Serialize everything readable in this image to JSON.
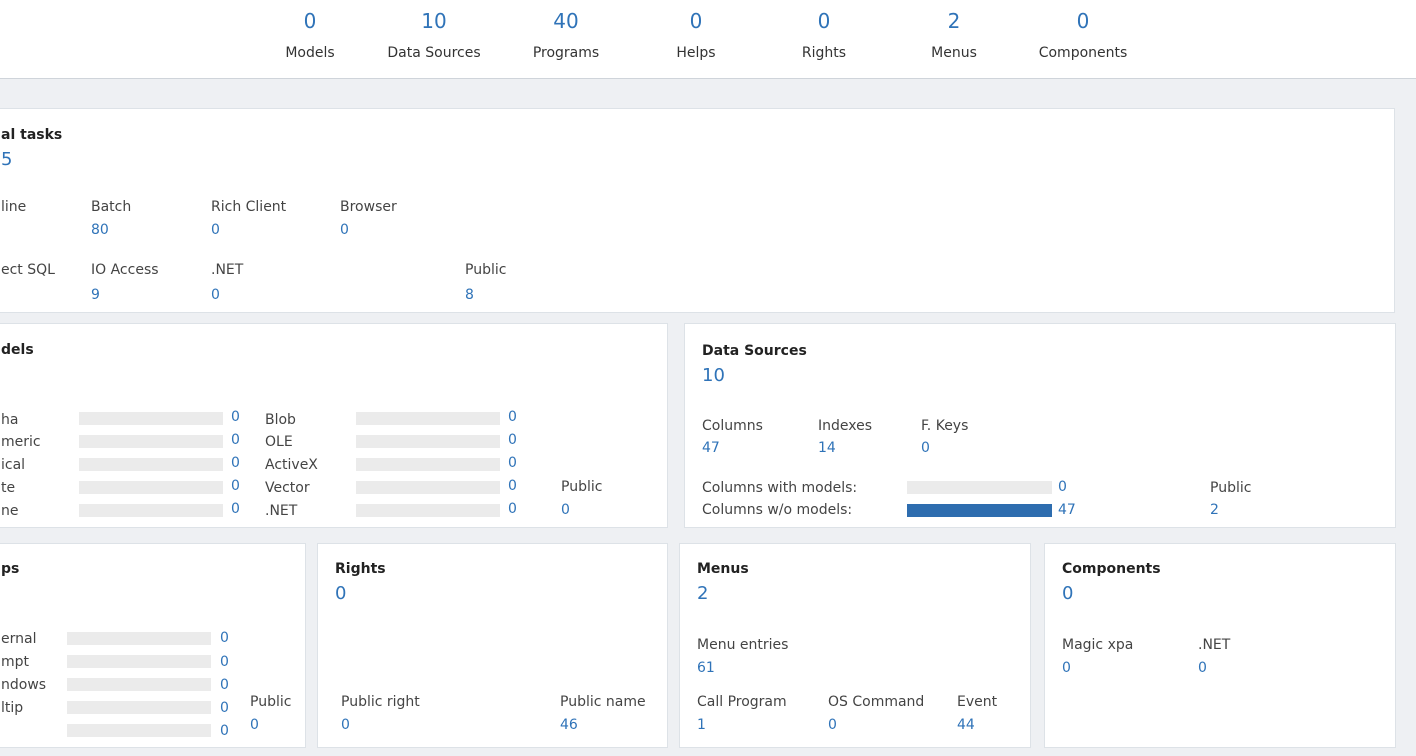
{
  "stats": [
    {
      "value": "0",
      "label": "Models"
    },
    {
      "value": "10",
      "label": "Data Sources"
    },
    {
      "value": "40",
      "label": "Programs"
    },
    {
      "value": "0",
      "label": "Helps"
    },
    {
      "value": "0",
      "label": "Rights"
    },
    {
      "value": "2",
      "label": "Menus"
    },
    {
      "value": "0",
      "label": "Components"
    }
  ],
  "tasks": {
    "title": "al tasks",
    "total": "5",
    "online_label": "line",
    "batch_label": "Batch",
    "batch_value": "80",
    "rich_label": "Rich Client",
    "rich_value": "0",
    "browser_label": "Browser",
    "browser_value": "0",
    "sql_label": "ect SQL",
    "io_label": "IO Access",
    "io_value": "9",
    "net_label": ".NET",
    "net_value": "0",
    "public_label": "Public",
    "public_value": "8"
  },
  "models": {
    "title": "dels",
    "left_rows": [
      {
        "label": "ha",
        "value": "0",
        "fraction": 0
      },
      {
        "label": "meric",
        "value": "0",
        "fraction": 0
      },
      {
        "label": "ical",
        "value": "0",
        "fraction": 0
      },
      {
        "label": "te",
        "value": "0",
        "fraction": 0
      },
      {
        "label": "ne",
        "value": "0",
        "fraction": 0
      }
    ],
    "right_rows": [
      {
        "label": "Blob",
        "value": "0",
        "fraction": 0
      },
      {
        "label": "OLE",
        "value": "0",
        "fraction": 0
      },
      {
        "label": "ActiveX",
        "value": "0",
        "fraction": 0
      },
      {
        "label": "Vector",
        "value": "0",
        "fraction": 0
      },
      {
        "label": ".NET",
        "value": "0",
        "fraction": 0
      }
    ],
    "public_label": "Public",
    "public_value": "0"
  },
  "datasources": {
    "title": "Data Sources",
    "total": "10",
    "columns_label": "Columns",
    "columns_value": "47",
    "indexes_label": "Indexes",
    "indexes_value": "14",
    "fkeys_label": "F. Keys",
    "fkeys_value": "0",
    "with_models_label": "Columns with models:",
    "with_models_value": "0",
    "with_models_fraction": 0,
    "without_models_label": "Columns w/o models:",
    "without_models_value": "47",
    "without_models_fraction": 1,
    "public_label": "Public",
    "public_value": "2"
  },
  "helps": {
    "title": "ps",
    "rows": [
      {
        "label": "ernal",
        "value": "0",
        "fraction": 0
      },
      {
        "label": "mpt",
        "value": "0",
        "fraction": 0
      },
      {
        "label": "ndows",
        "value": "0",
        "fraction": 0
      },
      {
        "label": "ltip",
        "value": "0",
        "fraction": 0
      },
      {
        "label": "",
        "value": "0",
        "fraction": 0
      }
    ],
    "public_label": "Public",
    "public_value": "0"
  },
  "rights": {
    "title": "Rights",
    "total": "0",
    "public_right_label": "Public right",
    "public_right_value": "0",
    "public_name_label": "Public name",
    "public_name_value": "46"
  },
  "menus": {
    "title": "Menus",
    "total": "2",
    "entries_label": "Menu entries",
    "entries_value": "61",
    "call_label": "Call Program",
    "call_value": "1",
    "os_label": "OS Command",
    "os_value": "0",
    "event_label": "Event",
    "event_value": "44"
  },
  "components": {
    "title": "Components",
    "total": "0",
    "magic_label": "Magic xpa",
    "magic_value": "0",
    "net_label": ".NET",
    "net_value": "0"
  },
  "colors": {
    "accent": "#2f73b8",
    "bar_fill": "#2e6daf",
    "bar_track": "#ebebeb"
  }
}
